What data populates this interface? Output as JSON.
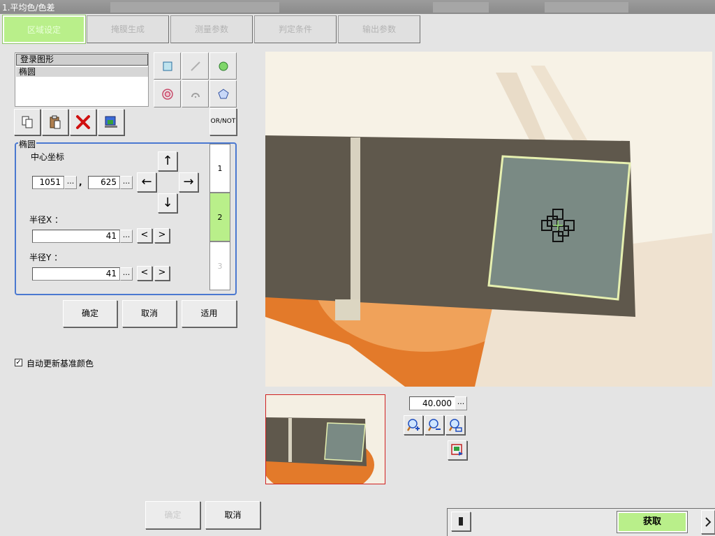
{
  "window": {
    "title": "1.平均色/色差"
  },
  "tabs": [
    {
      "label": "区域设定",
      "active": true
    },
    {
      "label": "掩膜生成",
      "active": false
    },
    {
      "label": "测量参数",
      "active": false
    },
    {
      "label": "判定条件",
      "active": false
    },
    {
      "label": "输出参数",
      "active": false
    }
  ],
  "region_list": {
    "header": "登录图形",
    "items": [
      "椭圆"
    ]
  },
  "shape_tools": [
    "rectangle-icon",
    "line-icon",
    "circle-icon",
    "ring-icon",
    "arc-icon",
    "polygon-icon"
  ],
  "or_not_label": "OR/NOT",
  "edit_tools": [
    "copy-icon",
    "paste-icon",
    "delete-icon",
    "image-settings-icon"
  ],
  "ellipse_group": {
    "title": "椭圆",
    "center_label": "中心坐标",
    "center_x": "1051",
    "center_y": "625",
    "comma": ",",
    "radius_x_label": "半径X ：",
    "radius_x": "41",
    "radius_y_label": "半径Y ：",
    "radius_y": "41",
    "dots": "...",
    "arrows": {
      "up": "↑",
      "down": "↓",
      "left": "←",
      "right": "→"
    },
    "steppers": {
      "dec": "<",
      "inc": ">"
    },
    "pages": [
      "1",
      "2",
      "3"
    ],
    "selected_page": "2"
  },
  "buttons": {
    "ok": "确定",
    "cancel": "取消",
    "apply": "适用",
    "bottom_ok": "确定",
    "bottom_cancel": "取消",
    "acquire": "获取"
  },
  "auto_update": {
    "label": "自动更新基准颜色",
    "checked": true,
    "mark": "✓"
  },
  "zoom": {
    "value": "40.000"
  },
  "colors": {
    "tab_active": "#b9ef8a",
    "group_border": "#4a78d0",
    "thumb_border": "#d02020"
  }
}
